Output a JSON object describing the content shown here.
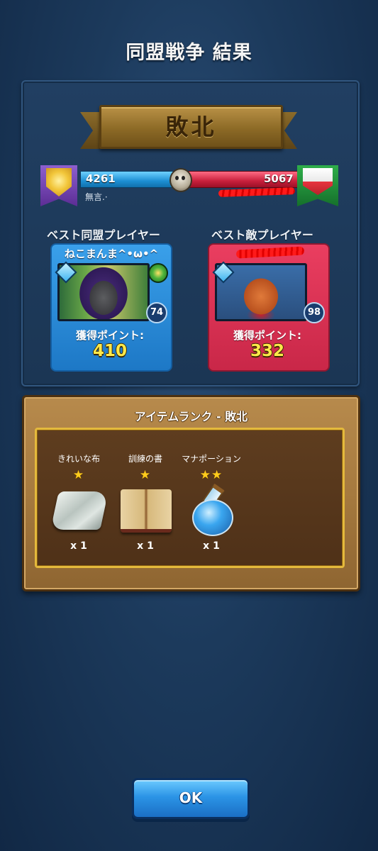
{
  "screen_title": "同盟戦争 結果",
  "result_banner": "敗北",
  "score_bar": {
    "ally_score": "4261",
    "enemy_score": "5067",
    "ally_name": "無言.·",
    "ally_ratio": 0.457
  },
  "best_players": {
    "ally": {
      "heading": "ベスト同盟プレイヤー",
      "name": "ねこまんま^•ω•^",
      "level": "74",
      "points_label": "獲得ポイント:",
      "points": "410",
      "card_color": "#2a8cdc"
    },
    "enemy": {
      "heading": "ベスト敵プレイヤー",
      "level": "98",
      "points_label": "獲得ポイント:",
      "points": "332",
      "card_color": "#dc3456"
    }
  },
  "rewards": {
    "title": "アイテムランク - 敗北",
    "items": [
      {
        "name": "きれいな布",
        "stars": "★",
        "quantity": "x 1",
        "icon": "cloth-icon"
      },
      {
        "name": "訓練の書",
        "stars": "★",
        "quantity": "x 1",
        "icon": "book-icon"
      },
      {
        "name": "マナポーション",
        "stars": "★★",
        "quantity": "x 1",
        "icon": "potion-icon"
      }
    ]
  },
  "ok_button": "OK"
}
